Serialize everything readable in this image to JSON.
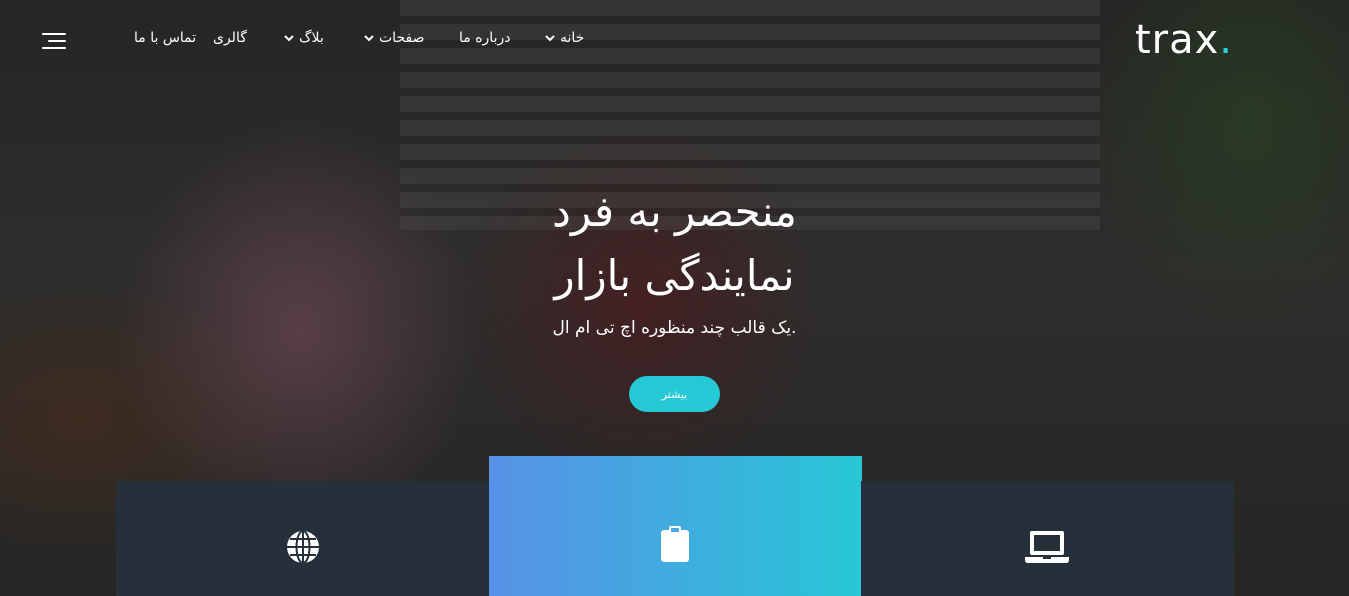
{
  "brand": {
    "logo_text": "trax",
    "logo_dot": ".",
    "accent_color": "#2bd0db"
  },
  "nav": {
    "items": [
      {
        "label": "خانه",
        "has_dropdown": true
      },
      {
        "label": "درباره ما",
        "has_dropdown": false
      },
      {
        "label": "صفحات",
        "has_dropdown": true
      },
      {
        "label": "بلاگ",
        "has_dropdown": true
      },
      {
        "label": "گالری",
        "has_dropdown": false
      },
      {
        "label": "تماس با ما",
        "has_dropdown": false
      }
    ],
    "menu_icon": "hamburger-menu-icon"
  },
  "hero": {
    "title_line1": "منحصر به فرد",
    "title_line2": "نمایندگی بازار",
    "subtitle": ".یک قالب چند منظوره اچ تی ام ال",
    "button_label": "بیشتر",
    "button_color": "#25c9d6"
  },
  "features": [
    {
      "icon": "globe-icon"
    },
    {
      "icon": "clipboard-icon"
    },
    {
      "icon": "laptop-icon"
    }
  ]
}
